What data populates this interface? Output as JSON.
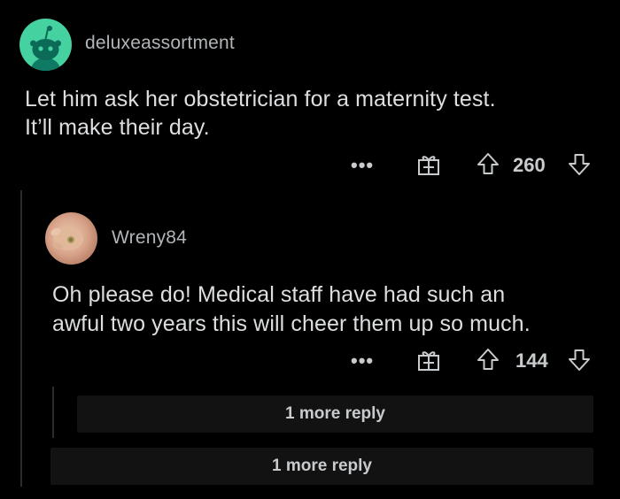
{
  "comments": [
    {
      "username": "deluxeassortment",
      "text_line1": "Let him ask her obstetrician for a maternity test.",
      "text_line2": "It’ll make their day.",
      "more_label": "•••",
      "score": "260"
    },
    {
      "username": "Wreny84",
      "text_line1": "Oh please do! Medical staff have had such an",
      "text_line2": "awful two years this will cheer them up so much.",
      "more_label": "•••",
      "score": "144"
    }
  ],
  "more_replies": [
    {
      "label": "1 more reply"
    },
    {
      "label": "1 more reply"
    }
  ],
  "colors": {
    "background": "#000000",
    "avatar1": "#46d1a0",
    "text": "#dcdee0",
    "muted": "#b1b5b8",
    "panel": "#121212"
  }
}
